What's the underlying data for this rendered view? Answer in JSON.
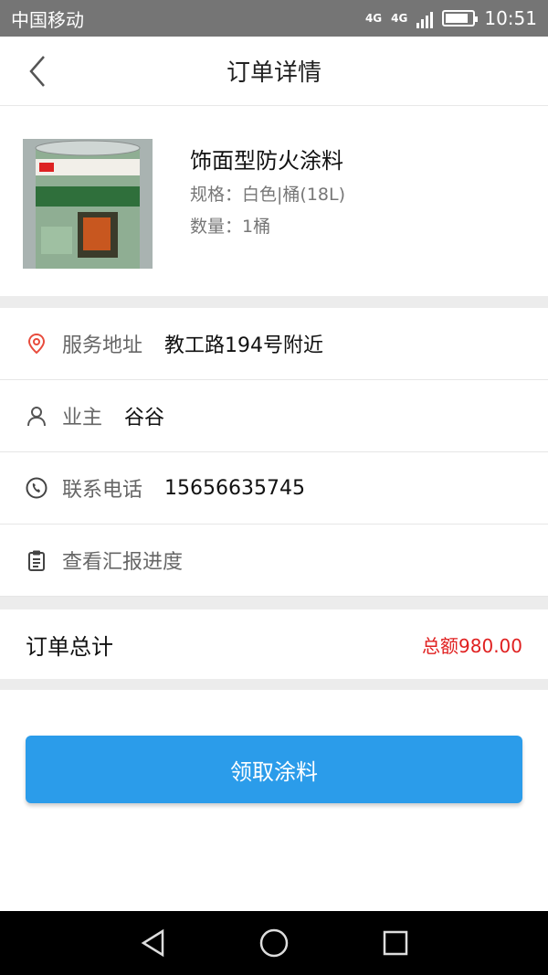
{
  "status_bar": {
    "carrier": "中国移动",
    "network_1": "4G",
    "network_2": "4G",
    "time": "10:51",
    "battery_level": 0.85
  },
  "header": {
    "title": "订单详情",
    "back_icon": "chevron-left-icon"
  },
  "product": {
    "name": "饰面型防火涂料",
    "spec": "规格：白色|桶(18L)",
    "quantity": "数量：1桶"
  },
  "info": {
    "address": {
      "icon": "location-pin-icon",
      "label": "服务地址",
      "value": "教工路194号附近"
    },
    "owner": {
      "icon": "user-icon",
      "label": "业主",
      "value": "谷谷"
    },
    "phone": {
      "icon": "phone-icon",
      "label": "联系电话",
      "value": "15656635745"
    },
    "report": {
      "icon": "clipboard-icon",
      "label": "查看汇报进度"
    }
  },
  "order": {
    "total_label": "订单总计",
    "total_amount": "总额980.00"
  },
  "action": {
    "claim_label": "领取涂料"
  },
  "colors": {
    "accent": "#2b9cea",
    "price": "#e02020",
    "pin": "#e84c3d",
    "status_bar": "#757575"
  }
}
